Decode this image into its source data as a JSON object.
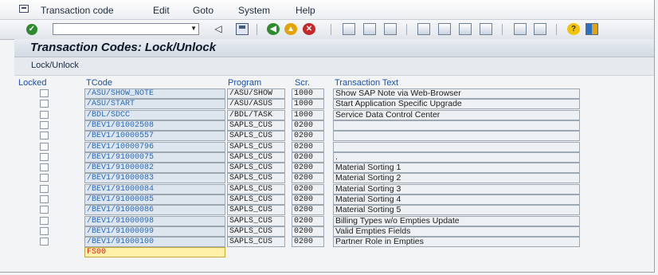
{
  "menu": [
    "Transaction code",
    "Edit",
    "Goto",
    "System",
    "Help"
  ],
  "toolbar": {
    "command_value": "",
    "icons": [
      "enter-icon",
      "back-icon",
      "save-icon",
      "back-green-icon",
      "exit-icon",
      "cancel-icon",
      "print-icon",
      "find-icon",
      "find-next-icon",
      "first-page-icon",
      "previous-page-icon",
      "next-page-icon",
      "last-page-icon",
      "create-session-icon",
      "shortcut-icon",
      "help-icon",
      "layout-icon"
    ]
  },
  "title": "Transaction Codes: Lock/Unlock",
  "app_button": "Lock/Unlock",
  "columns": {
    "locked": "Locked",
    "tcode": "TCode",
    "program": "Program",
    "screen": "Scr.",
    "text": "Transaction Text"
  },
  "rows": [
    {
      "tcode": "/ASU/SHOW_NOTE",
      "program": "/ASU/SHOW",
      "screen": "1000",
      "text": "Show SAP Note via Web-Browser"
    },
    {
      "tcode": "/ASU/START",
      "program": "/ASU/ASUS",
      "screen": "1000",
      "text": "Start Application Specific Upgrade"
    },
    {
      "tcode": "/BDL/SDCC",
      "program": "/BDL/TASK",
      "screen": "1000",
      "text": "Service Data Control Center"
    },
    {
      "tcode": "/BEV1/01002508",
      "program": "SAPLS_CUS",
      "screen": "0200",
      "text": ""
    },
    {
      "tcode": "/BEV1/10000557",
      "program": "SAPLS_CUS",
      "screen": "0200",
      "text": ""
    },
    {
      "tcode": "/BEV1/10000796",
      "program": "SAPLS_CUS",
      "screen": "0200",
      "text": ""
    },
    {
      "tcode": "/BEV1/91000075",
      "program": "SAPLS_CUS",
      "screen": "0200",
      "text": "."
    },
    {
      "tcode": "/BEV1/91000082",
      "program": "SAPLS_CUS",
      "screen": "0200",
      "text": "Material Sorting 1"
    },
    {
      "tcode": "/BEV1/91000083",
      "program": "SAPLS_CUS",
      "screen": "0200",
      "text": "Material Sorting 2"
    },
    {
      "tcode": "/BEV1/91000084",
      "program": "SAPLS_CUS",
      "screen": "0200",
      "text": "Material Sorting 3"
    },
    {
      "tcode": "/BEV1/91000085",
      "program": "SAPLS_CUS",
      "screen": "0200",
      "text": "Material Sorting 4"
    },
    {
      "tcode": "/BEV1/91000086",
      "program": "SAPLS_CUS",
      "screen": "0200",
      "text": "Material Sorting 5"
    },
    {
      "tcode": "/BEV1/91000098",
      "program": "SAPLS_CUS",
      "screen": "0200",
      "text": "Billing Types w/o Empties Update"
    },
    {
      "tcode": "/BEV1/91000099",
      "program": "SAPLS_CUS",
      "screen": "0200",
      "text": "Valid Empties Fields"
    },
    {
      "tcode": "/BEV1/91000100",
      "program": "SAPLS_CUS",
      "screen": "0200",
      "text": "Partner Role in Empties"
    }
  ],
  "new_entry": "FS00"
}
